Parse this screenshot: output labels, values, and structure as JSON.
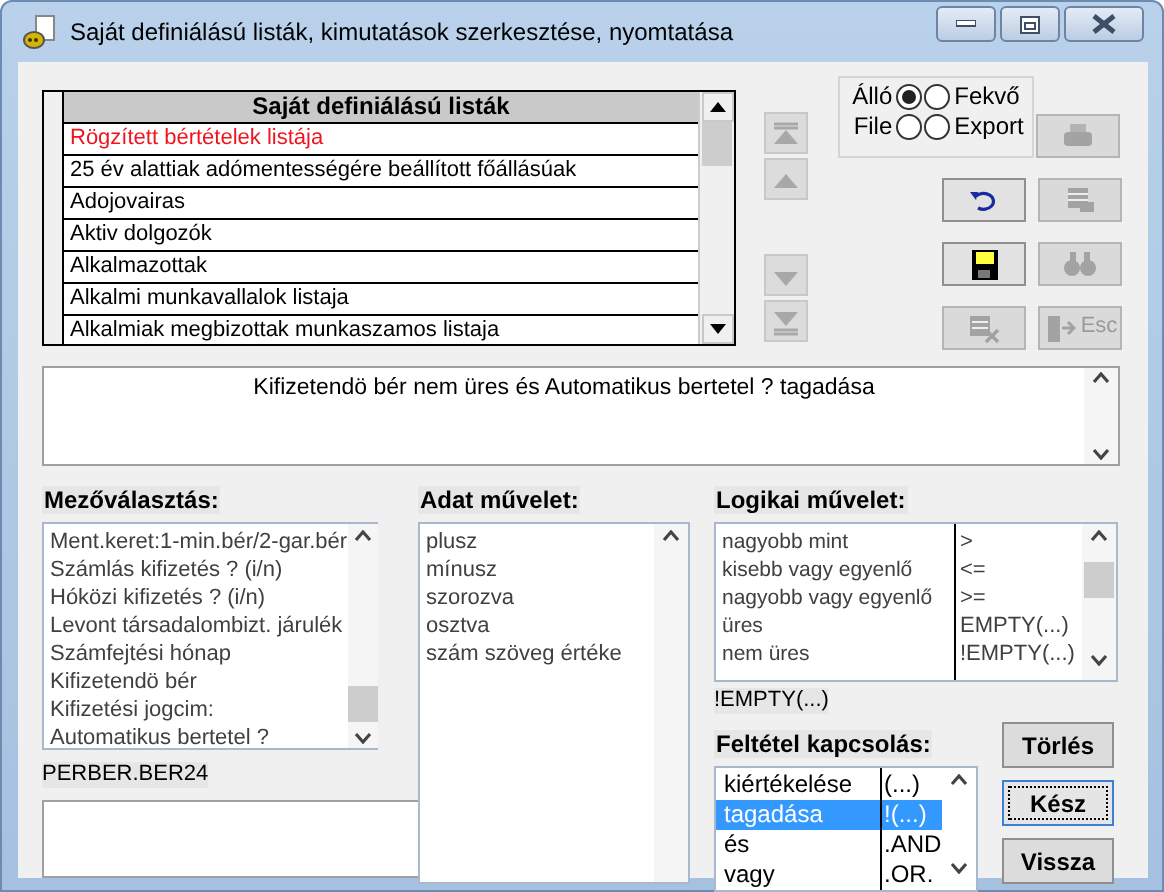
{
  "window": {
    "title": "Saját definiálású listák, kimutatások szerkesztése, nyomtatása"
  },
  "list_table": {
    "header": "Saját definiálású listák",
    "rows": [
      {
        "text": "Rögzített bértételek listája",
        "selected": true
      },
      {
        "text": "25 év alattiak adómentességére beállított főállásúak",
        "selected": false
      },
      {
        "text": "Adojovairas",
        "selected": false
      },
      {
        "text": "Aktiv dolgozók",
        "selected": false
      },
      {
        "text": "Alkalmazottak",
        "selected": false
      },
      {
        "text": "Alkalmi munkavallalok listaja",
        "selected": false
      },
      {
        "text": "Alkalmiak megbizottak munkaszamos listaja",
        "selected": false
      }
    ]
  },
  "nav_buttons": [
    {
      "kind": "first",
      "disabled": true
    },
    {
      "kind": "up",
      "disabled": true
    },
    {
      "kind": "down",
      "disabled": true
    },
    {
      "kind": "last",
      "disabled": true
    }
  ],
  "page_options": [
    {
      "label": "Álló",
      "selected": true
    },
    {
      "label": "Fekvő",
      "selected": false
    },
    {
      "label": "File",
      "selected": false
    },
    {
      "label": "Export",
      "selected": false
    }
  ],
  "tool_buttons": [
    {
      "kind": "print",
      "disabled": true
    },
    {
      "kind": "undo",
      "disabled": false
    },
    {
      "kind": "records",
      "disabled": true
    },
    {
      "kind": "save",
      "disabled": false
    },
    {
      "kind": "find",
      "disabled": true
    },
    {
      "kind": "delete",
      "disabled": true
    },
    {
      "kind": "exit",
      "label": "Esc",
      "disabled": true
    }
  ],
  "expression": "Kifizetendö bér nem üres és Automatikus bertetel ? tagadása",
  "field_select": {
    "label": "Mezőválasztás:",
    "items": [
      "Ment.keret:1-min.bér/2-gar.bér",
      "Számlás kifizetés ? (i/n)",
      "Hóközi kifizetés ? (i/n)",
      "Levont társadalombizt. járulék",
      "Számfejtési hónap",
      "Kifizetendö bér",
      "Kifizetési jogcim:",
      "Automatikus bertetel ?"
    ],
    "value": "PERBER.BER24"
  },
  "data_operation": {
    "label": "Adat művelet:",
    "items": [
      "plusz",
      "mínusz",
      "szorozva",
      "osztva",
      "szám szöveg értéke"
    ]
  },
  "logical_operation": {
    "label": "Logikai művelet:",
    "rows": [
      {
        "name": "nagyobb mint",
        "symbol": ">"
      },
      {
        "name": "kisebb vagy egyenlő",
        "symbol": "<="
      },
      {
        "name": "nagyobb vagy egyenlő",
        "symbol": ">="
      },
      {
        "name": "üres",
        "symbol": "EMPTY(...)"
      },
      {
        "name": "nem üres",
        "symbol": "!EMPTY(...)"
      }
    ],
    "value": "!EMPTY(...)"
  },
  "condition_link": {
    "label": "Feltétel kapcsolás:",
    "rows": [
      {
        "name": "kiértékelése",
        "symbol": "(...)",
        "selected": false
      },
      {
        "name": "tagadása",
        "symbol": "!(...)",
        "selected": true
      },
      {
        "name": "és",
        "symbol": ".AND",
        "selected": false
      },
      {
        "name": "vagy",
        "symbol": ".OR.",
        "selected": false
      }
    ]
  },
  "buttons": [
    {
      "label": "Törlés",
      "focused": false
    },
    {
      "label": "Kész",
      "focused": true
    },
    {
      "label": "Vissza",
      "focused": false
    }
  ]
}
